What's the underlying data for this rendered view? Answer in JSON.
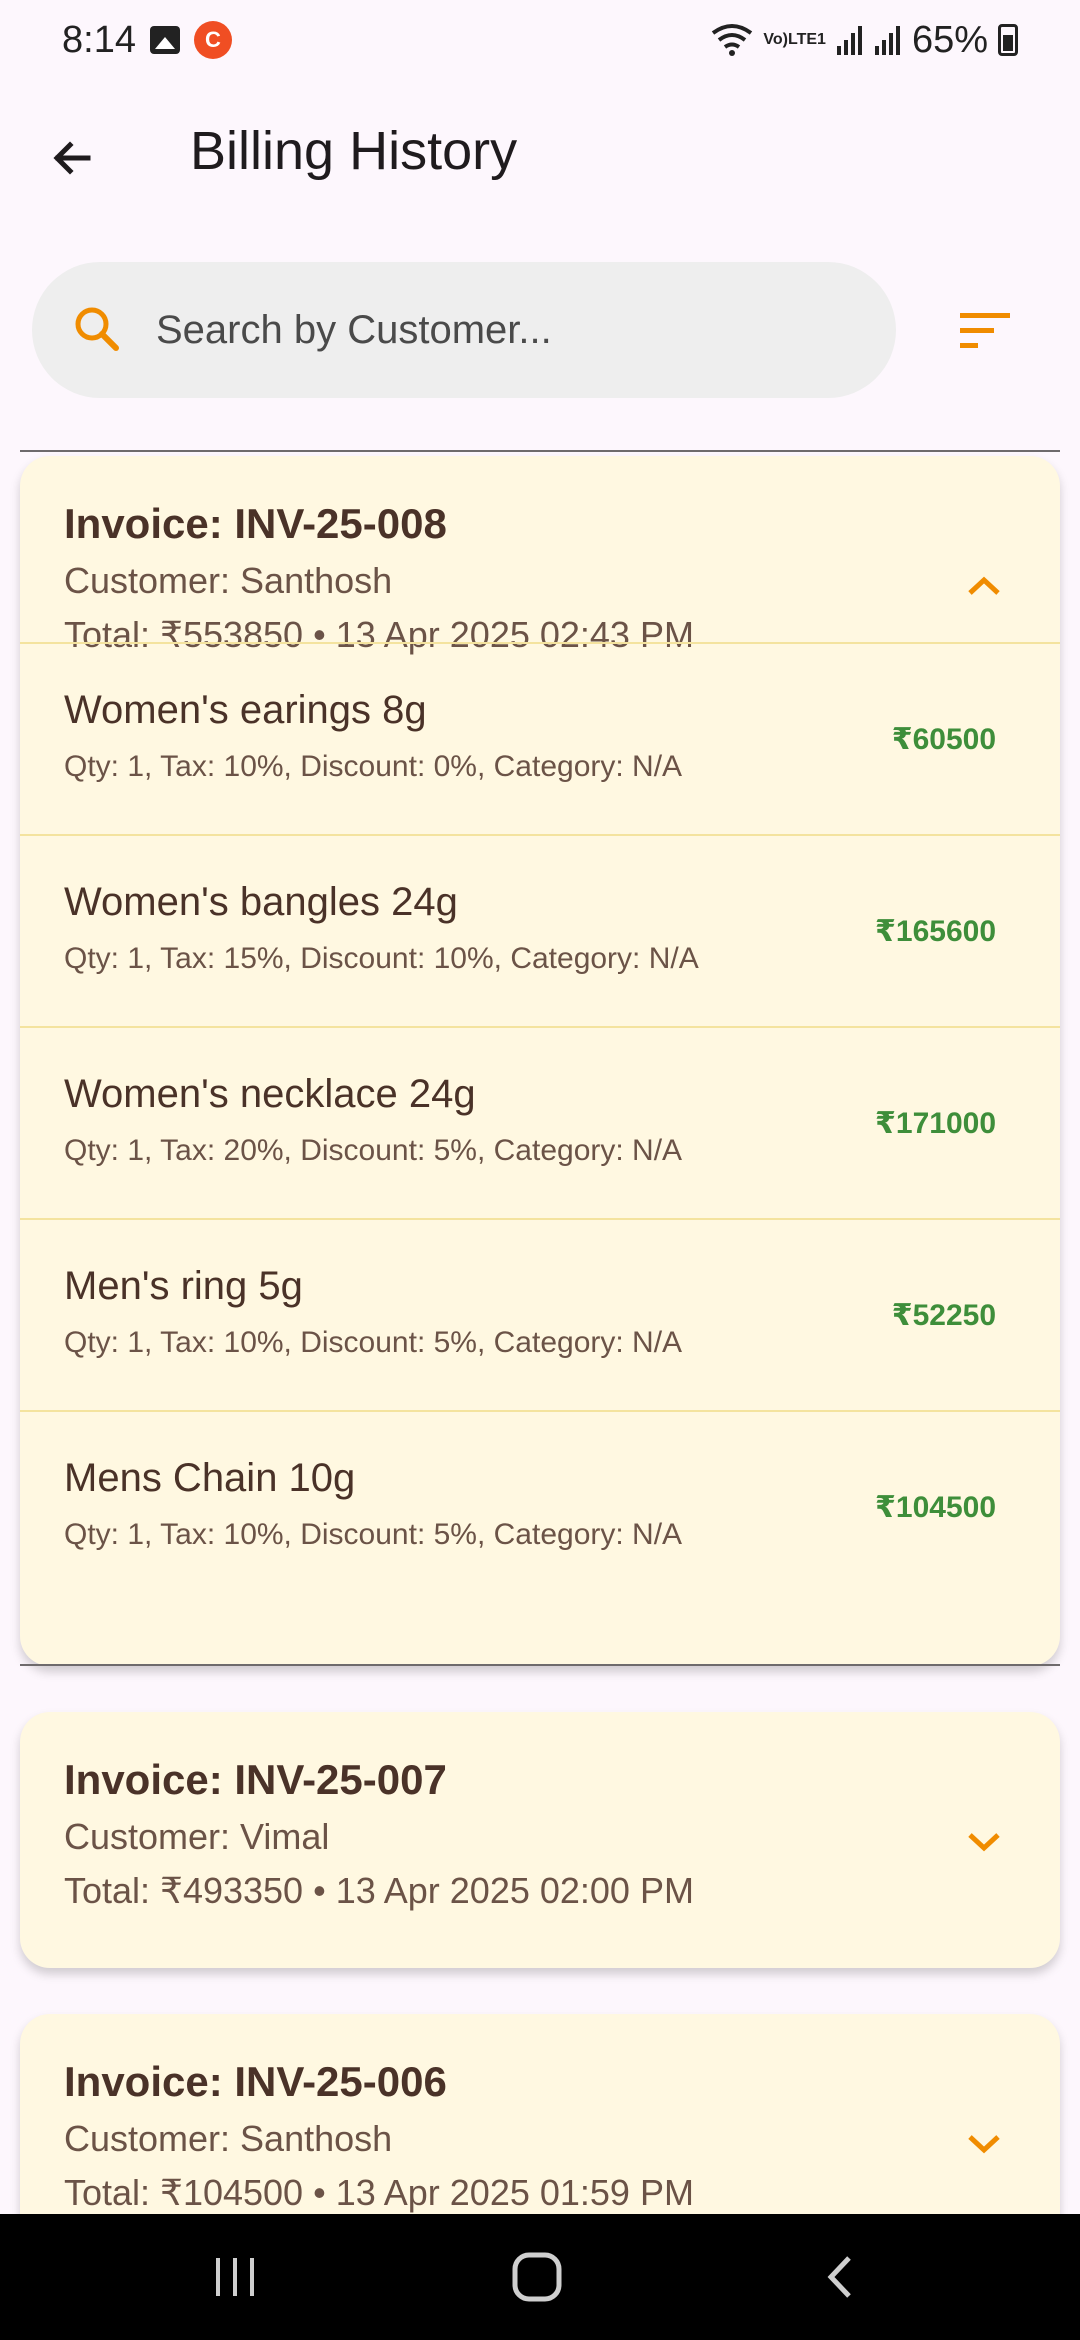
{
  "status": {
    "time": "8:14",
    "battery": "65%",
    "network": "LTE1"
  },
  "header": {
    "title": "Billing History"
  },
  "search": {
    "placeholder": "Search by Customer..."
  },
  "colors": {
    "accent": "#F08C00",
    "card_bg": "#FFF8E1",
    "price_green": "#3E8E3A"
  },
  "invoices": [
    {
      "title": "Invoice: INV-25-008",
      "customer": "Customer: Santhosh",
      "total": "Total: ₹553850 • 13 Apr 2025 02:43 PM",
      "expanded": true,
      "items": [
        {
          "name": "Women's earings 8g",
          "detail": "Qty: 1, Tax: 10%, Discount: 0%, Category: N/A",
          "price": "₹60500"
        },
        {
          "name": "Women's bangles 24g",
          "detail": "Qty: 1, Tax: 15%, Discount: 10%, Category: N/A",
          "price": "₹165600"
        },
        {
          "name": "Women's necklace 24g",
          "detail": "Qty: 1, Tax: 20%, Discount: 5%, Category: N/A",
          "price": "₹171000"
        },
        {
          "name": "Men's ring 5g",
          "detail": "Qty: 1, Tax: 10%, Discount: 5%, Category: N/A",
          "price": "₹52250"
        },
        {
          "name": "Mens Chain 10g",
          "detail": "Qty: 1, Tax: 10%, Discount: 5%, Category: N/A",
          "price": "₹104500"
        }
      ]
    },
    {
      "title": "Invoice: INV-25-007",
      "customer": "Customer: Vimal",
      "total": "Total: ₹493350 • 13 Apr 2025 02:00 PM",
      "expanded": false
    },
    {
      "title": "Invoice: INV-25-006",
      "customer": "Customer: Santhosh",
      "total": "Total: ₹104500 • 13 Apr 2025 01:59 PM",
      "expanded": false
    }
  ],
  "icons": {
    "back": "arrow-back-icon",
    "search": "search-icon",
    "sort": "sort-icon",
    "collapse": "chevron-up-icon",
    "expand": "chevron-down-icon"
  }
}
